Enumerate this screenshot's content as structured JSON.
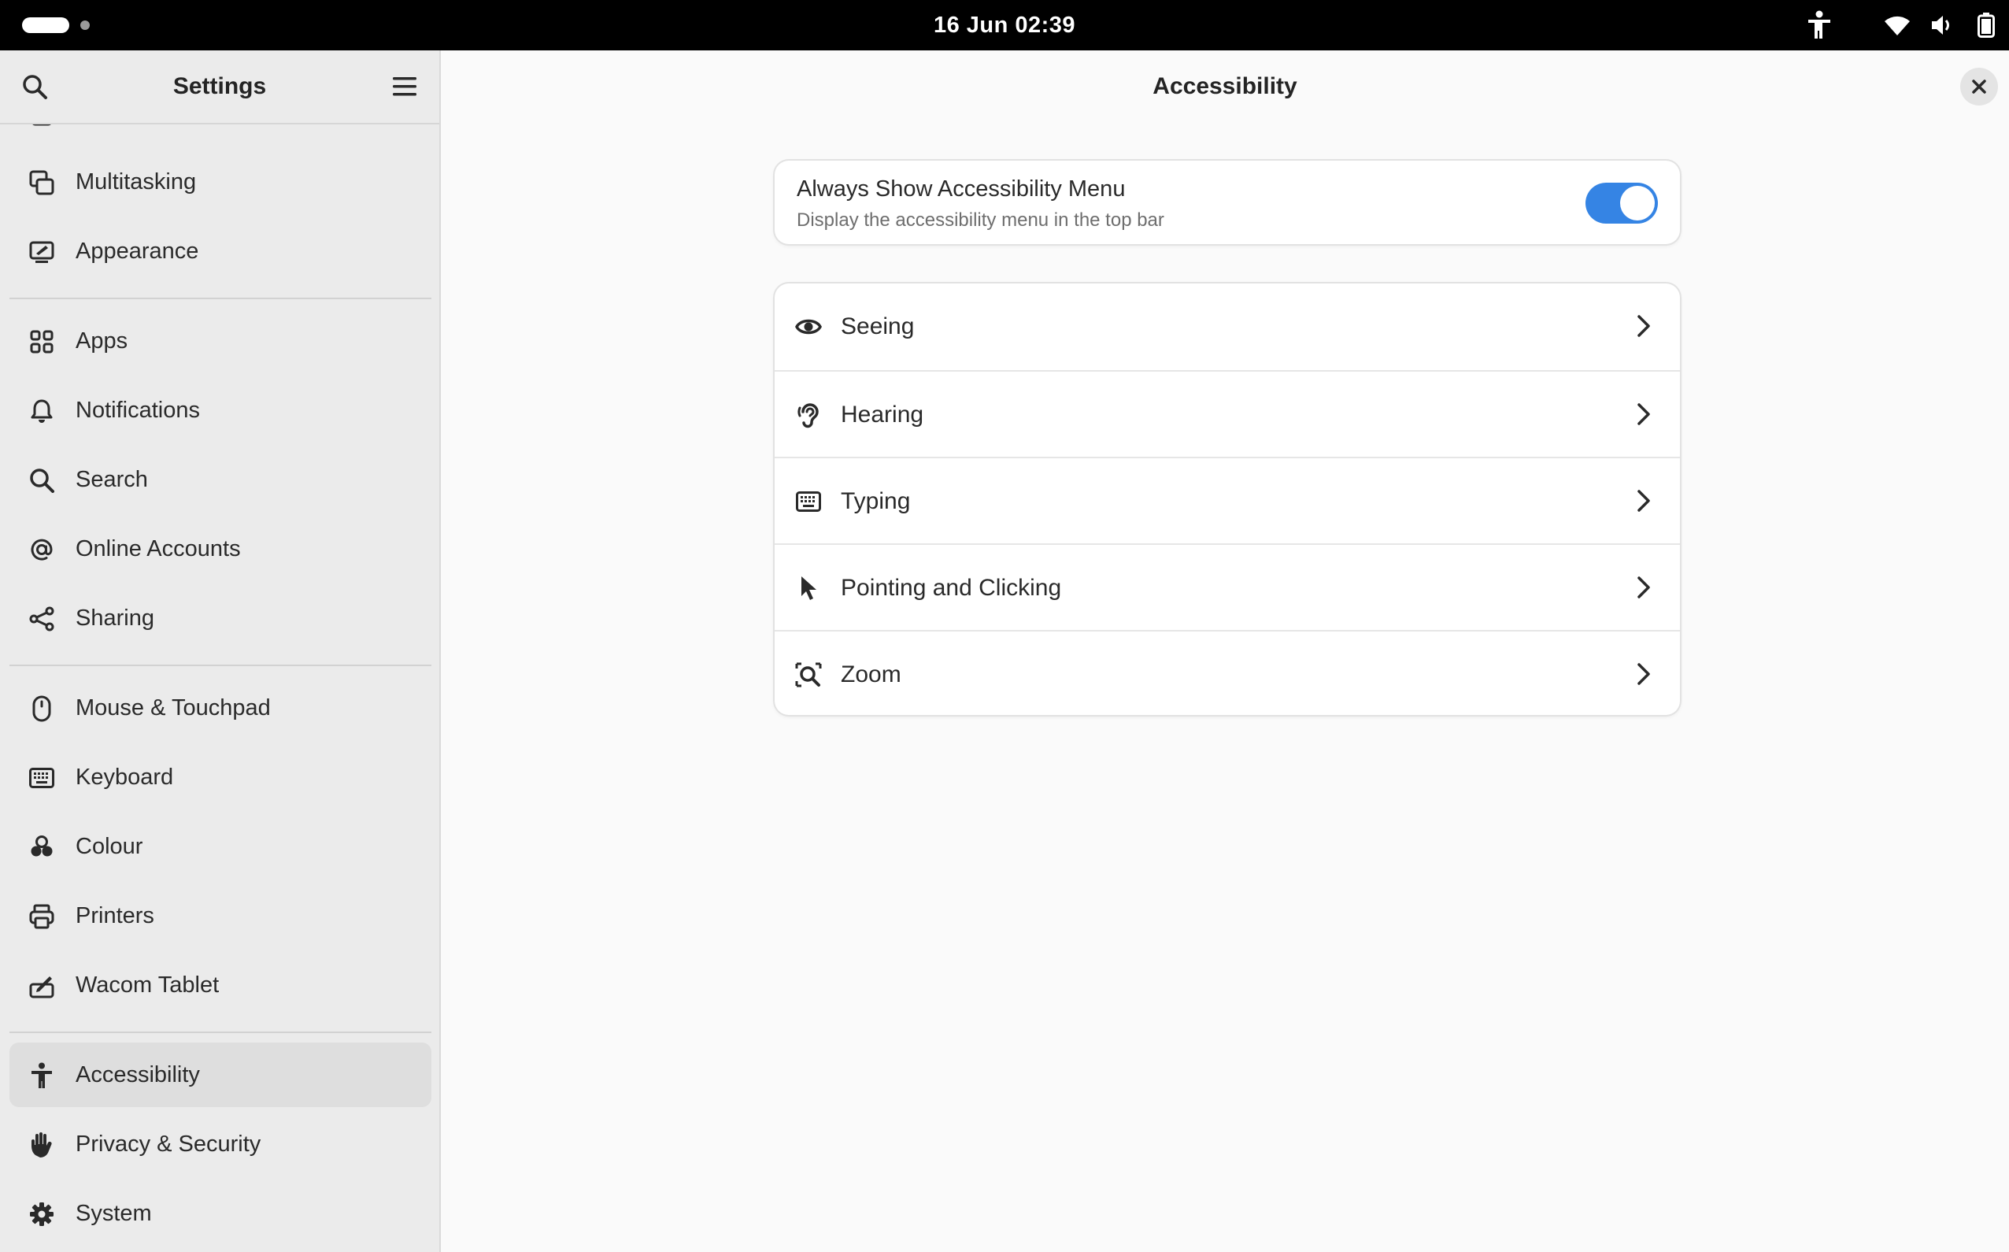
{
  "topbar": {
    "clock": "16 Jun  02:39",
    "status_icons": [
      "accessibility-icon",
      "wifi-icon",
      "volume-icon",
      "battery-icon"
    ]
  },
  "sidebar": {
    "title": "Settings",
    "items": [
      {
        "label": "Multitasking",
        "icon": "multitasking-icon"
      },
      {
        "label": "Appearance",
        "icon": "appearance-icon"
      },
      {
        "label": "Apps",
        "icon": "apps-icon"
      },
      {
        "label": "Notifications",
        "icon": "bell-icon"
      },
      {
        "label": "Search",
        "icon": "search-icon"
      },
      {
        "label": "Online Accounts",
        "icon": "at-icon"
      },
      {
        "label": "Sharing",
        "icon": "share-icon"
      },
      {
        "label": "Mouse & Touchpad",
        "icon": "mouse-icon"
      },
      {
        "label": "Keyboard",
        "icon": "keyboard-icon"
      },
      {
        "label": "Colour",
        "icon": "colour-icon"
      },
      {
        "label": "Printers",
        "icon": "printer-icon"
      },
      {
        "label": "Wacom Tablet",
        "icon": "tablet-icon"
      },
      {
        "label": "Accessibility",
        "icon": "accessibility-icon",
        "selected": true
      },
      {
        "label": "Privacy & Security",
        "icon": "hand-icon"
      },
      {
        "label": "System",
        "icon": "gear-icon"
      }
    ]
  },
  "main": {
    "title": "Accessibility",
    "toggle": {
      "title": "Always Show Accessibility Menu",
      "subtitle": "Display the accessibility menu in the top bar",
      "enabled": true
    },
    "rows": [
      {
        "label": "Seeing",
        "icon": "eye-icon"
      },
      {
        "label": "Hearing",
        "icon": "ear-icon"
      },
      {
        "label": "Typing",
        "icon": "keyboard-icon"
      },
      {
        "label": "Pointing and Clicking",
        "icon": "pointer-icon"
      },
      {
        "label": "Zoom",
        "icon": "zoom-icon"
      }
    ]
  },
  "colors": {
    "accent": "#3584e4",
    "topbar": "#000000",
    "sidebar": "#ebebeb",
    "content": "#fafafa"
  }
}
